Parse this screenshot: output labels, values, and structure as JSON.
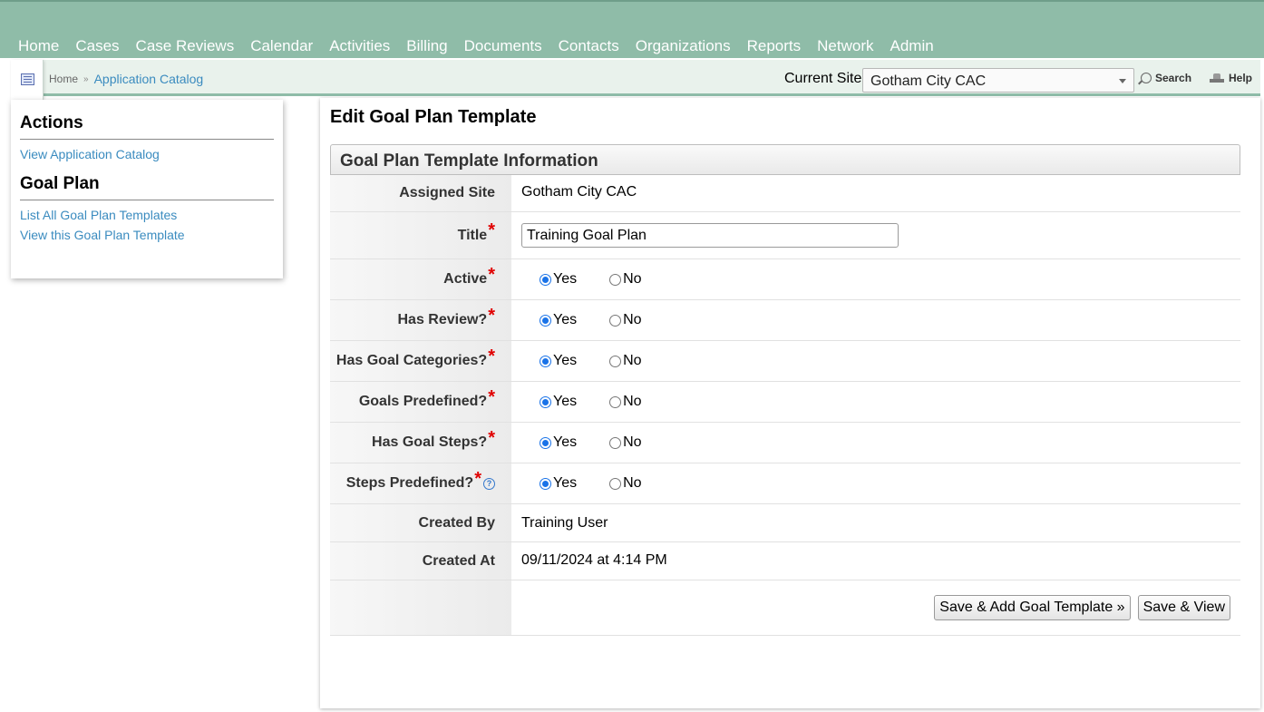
{
  "nav": [
    "Home",
    "Cases",
    "Case Reviews",
    "Calendar",
    "Activities",
    "Billing",
    "Documents",
    "Contacts",
    "Organizations",
    "Reports",
    "Network",
    "Admin"
  ],
  "breadcrumb": {
    "home": "Home",
    "sep": "»",
    "current": "Application Catalog"
  },
  "site": {
    "label": "Current Site",
    "value": "Gotham City CAC"
  },
  "toolbar": {
    "search": "Search",
    "help": "Help"
  },
  "sidebar": {
    "actions_title": "Actions",
    "actions": [
      "View Application Catalog"
    ],
    "goal_title": "Goal Plan",
    "goal_links": [
      "List All Goal Plan Templates",
      "View this Goal Plan Template"
    ]
  },
  "page": {
    "title": "Edit Goal Plan Template"
  },
  "panel": {
    "header": "Goal Plan Template Information",
    "assigned_site": {
      "label": "Assigned Site",
      "value": "Gotham City CAC"
    },
    "title": {
      "label": "Title",
      "value": "Training Goal Plan"
    },
    "radios": [
      {
        "label": "Active",
        "yes": "Yes",
        "no": "No",
        "selected": "Yes"
      },
      {
        "label": "Has Review?",
        "yes": "Yes",
        "no": "No",
        "selected": "Yes"
      },
      {
        "label": "Has Goal Categories?",
        "yes": "Yes",
        "no": "No",
        "selected": "Yes"
      },
      {
        "label": "Goals Predefined?",
        "yes": "Yes",
        "no": "No",
        "selected": "Yes"
      },
      {
        "label": "Has Goal Steps?",
        "yes": "Yes",
        "no": "No",
        "selected": "Yes"
      },
      {
        "label": "Steps Predefined?",
        "yes": "Yes",
        "no": "No",
        "selected": "Yes"
      }
    ],
    "created_by": {
      "label": "Created By",
      "value": "Training User"
    },
    "created_at": {
      "label": "Created At",
      "value": "09/11/2024 at 4:14 PM"
    },
    "required_mark": "*",
    "help_mark": "?"
  },
  "buttons": {
    "save_add": "Save & Add Goal Template »",
    "save_view": "Save & View"
  }
}
